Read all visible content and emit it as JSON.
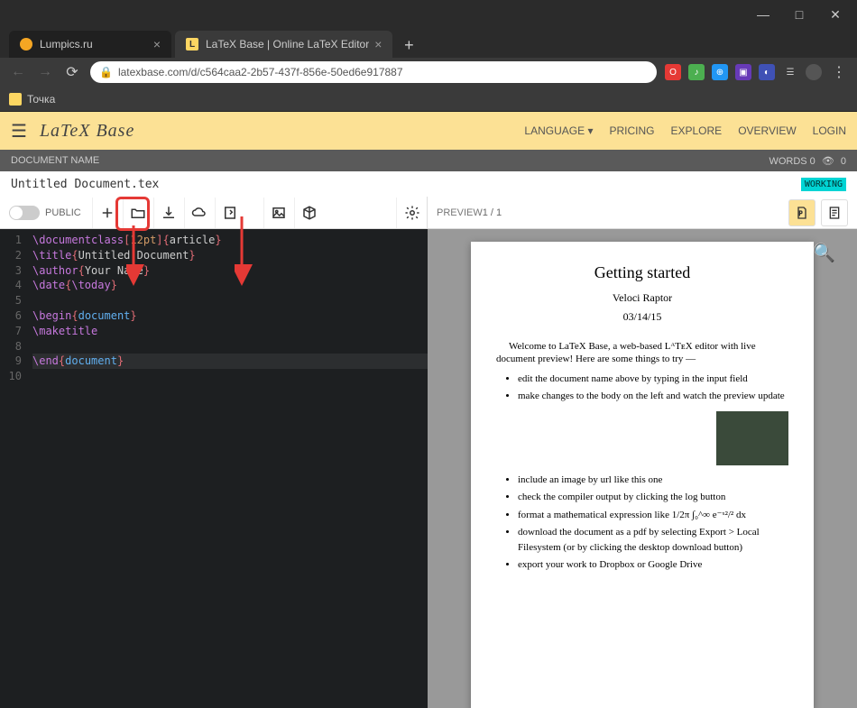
{
  "window": {
    "min": "—",
    "max": "□",
    "close": "✕"
  },
  "tabs": [
    {
      "title": "Lumpics.ru",
      "active": false,
      "icon": "orange"
    },
    {
      "title": "LaTeX Base | Online LaTeX Editor",
      "active": true,
      "icon": "lb"
    }
  ],
  "url": "latexbase.com/d/c564caa2-2b57-437f-856e-50ed6e917887",
  "bookmark": "Точка",
  "header": {
    "brand": "LaTeX Base",
    "menu": [
      "LANGUAGE ▾",
      "PRICING",
      "EXPLORE",
      "OVERVIEW",
      "LOGIN"
    ]
  },
  "docbar": {
    "label": "DOCUMENT NAME",
    "words": "WORDS 0",
    "views": "0"
  },
  "docname": "Untitled Document.tex",
  "status": "WORKING",
  "public_label": "PUBLIC",
  "preview_label": "PREVIEW",
  "page_indicator": "1 / 1",
  "code": {
    "lines": [
      "\\documentclass[12pt]{article}",
      "\\title{Untitled Document}",
      "\\author{Your Name}",
      "\\date{\\today}",
      "",
      "\\begin{document}",
      "\\maketitle",
      "",
      "\\end{document}"
    ]
  },
  "preview": {
    "title": "Getting started",
    "author": "Veloci Raptor",
    "date": "03/14/15",
    "intro": "Welcome to LaTeX Base, a web-based LᴬTᴇX editor with live document preview! Here are some things to try —",
    "items1": [
      "edit the document name above by typing in the input field",
      "make changes to the body on the left and watch the preview update"
    ],
    "items2": [
      "include an image by url like this one",
      "check the compiler output by clicking the log button",
      "format a mathematical expression like 1/2π ∫₀^∞ e⁻ˣ²/² dx",
      "download the document as a pdf by selecting Export > Local Filesystem (or by clicking the desktop download button)",
      "export your work to Dropbox or Google Drive"
    ]
  }
}
